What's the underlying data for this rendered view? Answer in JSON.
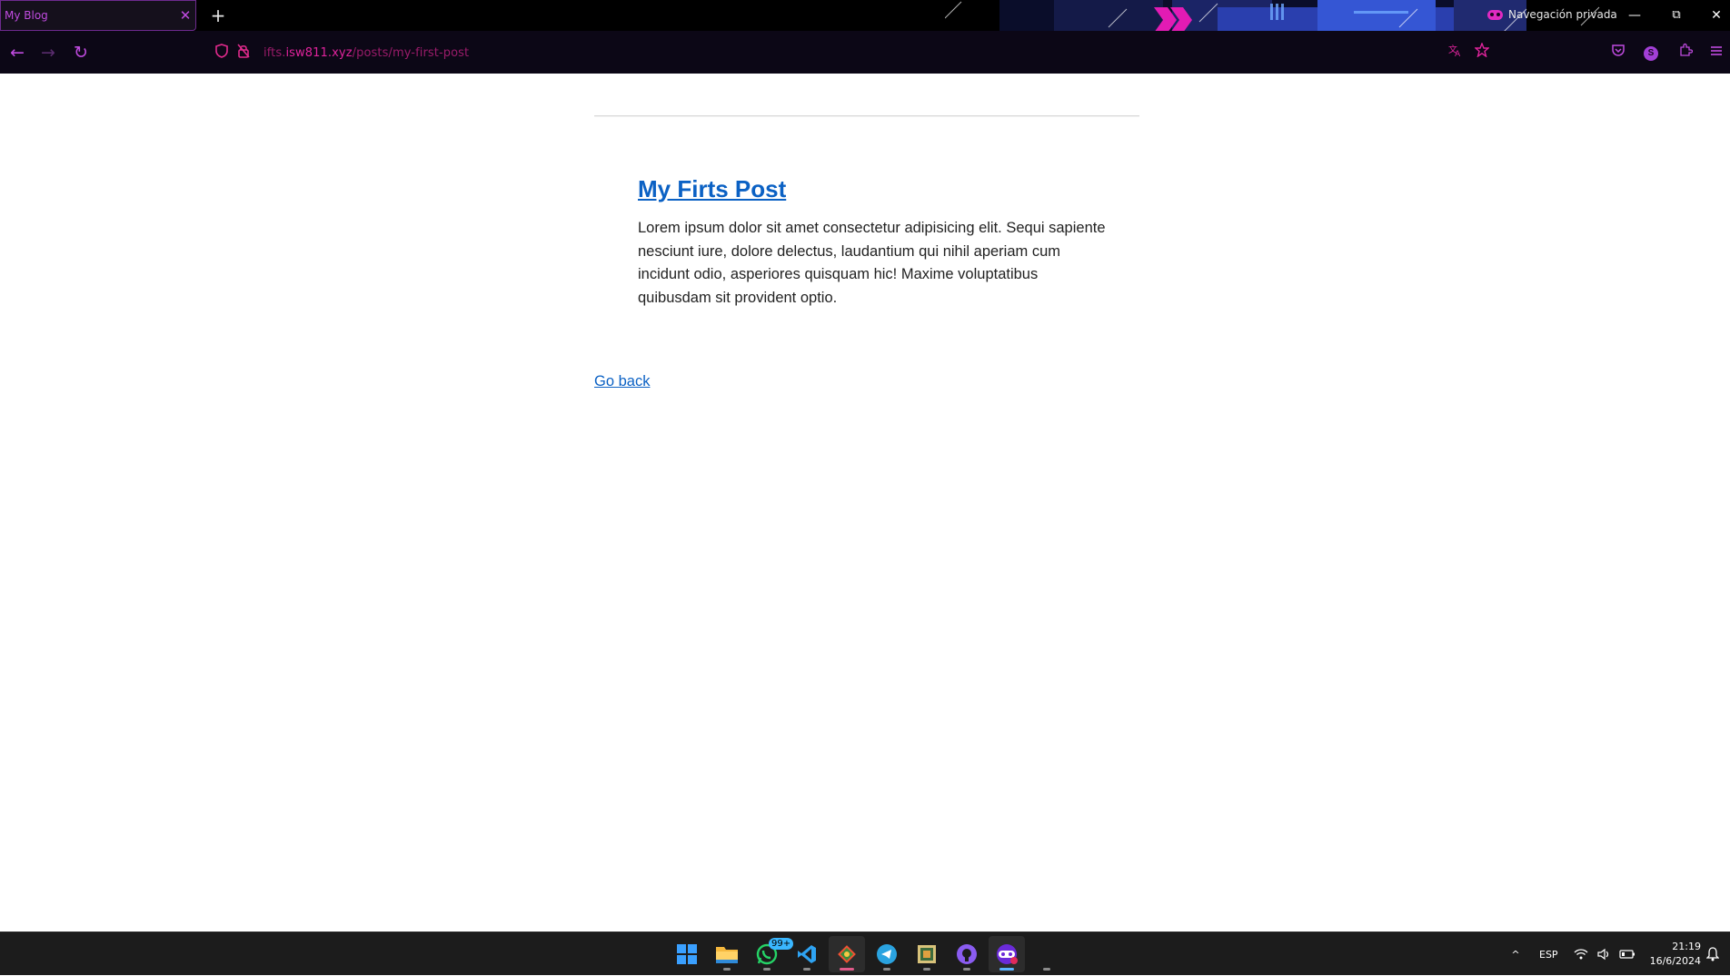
{
  "browser": {
    "tab": {
      "title": "My Blog",
      "close_glyph": "✕"
    },
    "new_tab_glyph": "+",
    "private_label": "Navegación privada",
    "window_controls": {
      "minimize": "—",
      "restore": "⧉",
      "close": "✕"
    },
    "nav": {
      "back_glyph": "←",
      "forward_glyph": "→",
      "reload_glyph": "↻"
    },
    "url": {
      "prefix": "ifts.",
      "host": "isw811.xyz",
      "path": "/posts/my-first-post"
    },
    "account_initial": "S",
    "icons": [
      "shield-icon",
      "lock-icon",
      "translate-icon",
      "star-icon",
      "pocket-icon",
      "account-icon",
      "extensions-icon",
      "menu-icon"
    ],
    "accent_color": "#c04be0"
  },
  "page": {
    "post": {
      "title": "My Firts Post",
      "body": "Lorem ipsum dolor sit amet consectetur adipisicing elit. Sequi sapiente nesciunt iure, dolore delectus, laudantium qui nihil aperiam cum incidunt odio, asperiores quisquam hic! Maxime voluptatibus quibusdam sit provident optio."
    },
    "go_back_label": "Go back",
    "link_color": "#0b61c4"
  },
  "taskbar": {
    "apps": [
      "start-icon",
      "file-explorer-icon",
      "whatsapp-icon",
      "vscode-icon",
      "git-icon",
      "telegram-icon",
      "image-viewer-icon",
      "github-icon",
      "firefox-private-icon"
    ],
    "whatsapp_badge": "99+",
    "tray": {
      "chevron": "^",
      "language": "ESP"
    },
    "clock": {
      "time": "21:19",
      "date": "16/6/2024"
    }
  }
}
